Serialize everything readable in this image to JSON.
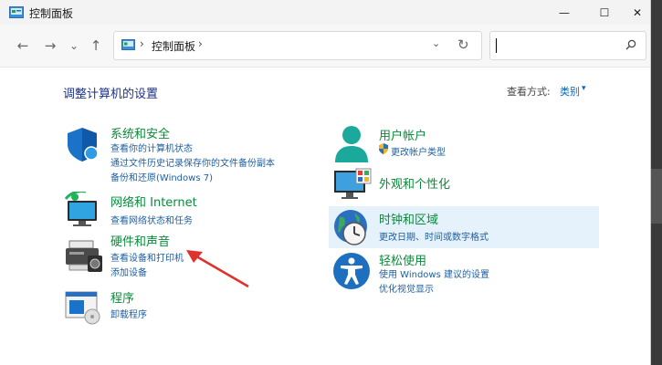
{
  "window": {
    "title": "控制面板",
    "minimize_glyph": "—",
    "maximize_glyph": "☐",
    "close_glyph": "✕"
  },
  "nav": {
    "back_glyph": "←",
    "forward_glyph": "→",
    "recent_glyph": "⌄",
    "up_glyph": "↑",
    "sep_glyph": "›",
    "address_text": "控制面板",
    "dropdown_glyph": "⌄",
    "refresh_glyph": "↻",
    "search_value": ""
  },
  "main": {
    "heading": "调整计算机的设置",
    "view_by_label": "查看方式:",
    "view_by_value": "类别",
    "view_by_caret": "▾"
  },
  "left_categories": [
    {
      "title": "系统和安全",
      "icon": "shield-icon",
      "links": [
        "查看你的计算机状态",
        "通过文件历史记录保存你的文件备份副本",
        "备份和还原(Windows 7)"
      ]
    },
    {
      "title": "网络和 Internet",
      "icon": "network-icon",
      "links": [
        "查看网络状态和任务"
      ]
    },
    {
      "title": "硬件和声音",
      "icon": "printer-icon",
      "links": [
        "查看设备和打印机",
        "添加设备"
      ]
    },
    {
      "title": "程序",
      "icon": "programs-icon",
      "links": [
        "卸载程序"
      ]
    }
  ],
  "right_categories": [
    {
      "title": "用户帐户",
      "icon": "user-icon",
      "links": [
        "更改帐户类型"
      ]
    },
    {
      "title": "外观和个性化",
      "icon": "appearance-icon",
      "links": []
    },
    {
      "title": "时钟和区域",
      "icon": "clock-globe-icon",
      "links": [
        "更改日期、时间或数字格式"
      ]
    },
    {
      "title": "轻松使用",
      "icon": "accessibility-icon",
      "links": [
        "使用 Windows 建议的设置",
        "优化视觉显示"
      ]
    }
  ],
  "colors": {
    "category_title": "#0a8a3a",
    "link": "#1e5fa0",
    "heading": "#1e3287",
    "annotation_arrow": "#e0322d",
    "hover": "#e5f1fb"
  }
}
